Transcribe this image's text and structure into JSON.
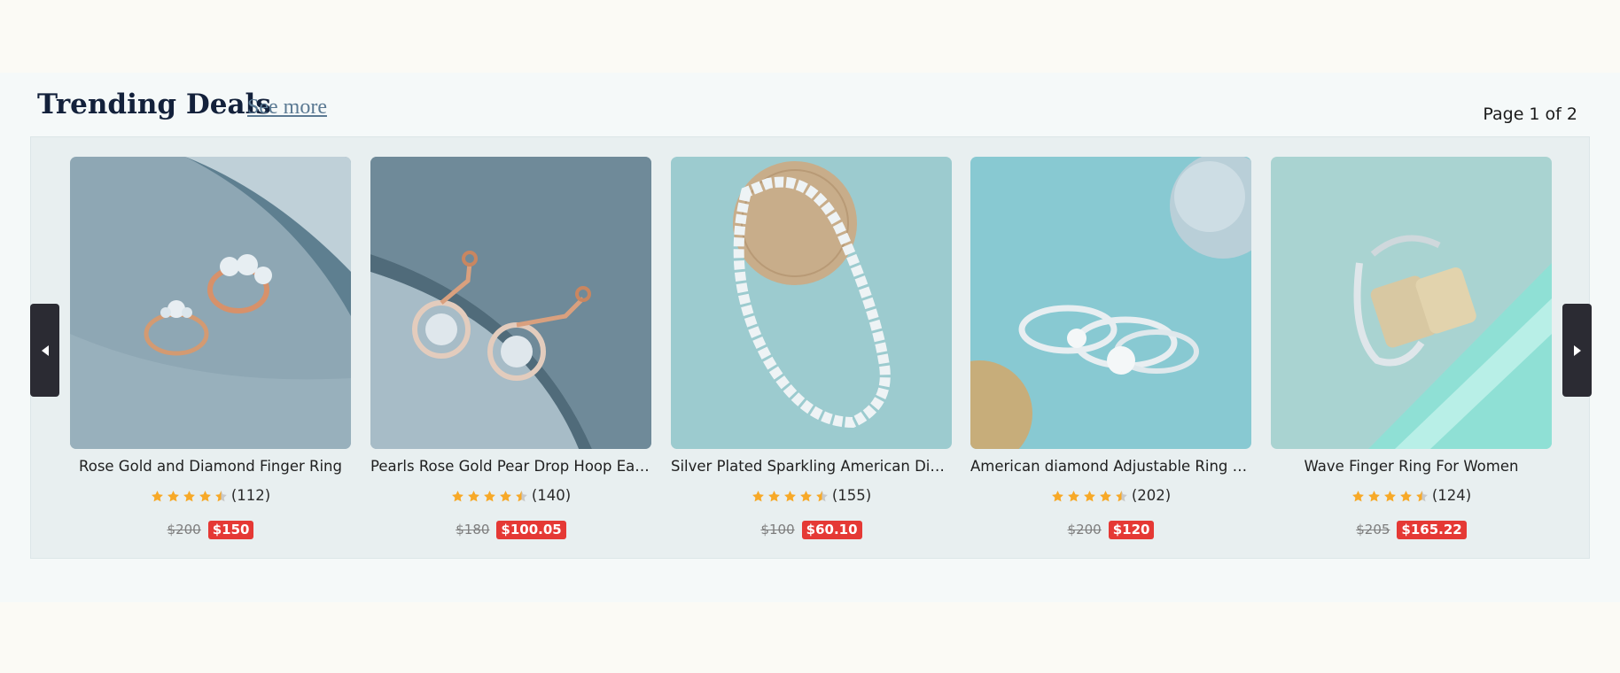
{
  "section": {
    "title": "Trending Deals",
    "see_more": "See more",
    "page_indicator": "Page 1 of 2"
  },
  "colors": {
    "star": "#f7a928",
    "sale_badge": "#e53935",
    "nav_button": "#2b2b33",
    "title": "#13213b"
  },
  "navigation": {
    "prev_icon": "caret-left-icon",
    "next_icon": "caret-right-icon"
  },
  "products": [
    {
      "name": "Rose Gold and Diamond Finger Ring",
      "rating": 4.5,
      "reviews": "(112)",
      "original_price": "$200",
      "sale_price": "$150",
      "image": "rose-gold-diamond-rings"
    },
    {
      "name": "Pearls Rose Gold Pear Drop Hoop Earrin...",
      "rating": 4.5,
      "reviews": "(140)",
      "original_price": "$180",
      "sale_price": "$100.05",
      "image": "pear-drop-hoop-earrings"
    },
    {
      "name": "Silver Plated Sparkling American Diam...",
      "rating": 4.5,
      "reviews": "(155)",
      "original_price": "$100",
      "sale_price": "$60.10",
      "image": "silver-diamond-necklace"
    },
    {
      "name": "American diamond Adjustable Ring Co...",
      "rating": 4.5,
      "reviews": "(202)",
      "original_price": "$200",
      "sale_price": "$120",
      "image": "silver-diamond-ring-combo"
    },
    {
      "name": "Wave Finger Ring For Women",
      "rating": 4.5,
      "reviews": "(124)",
      "original_price": "$205",
      "sale_price": "$165.22",
      "image": "wave-finger-ring"
    }
  ]
}
